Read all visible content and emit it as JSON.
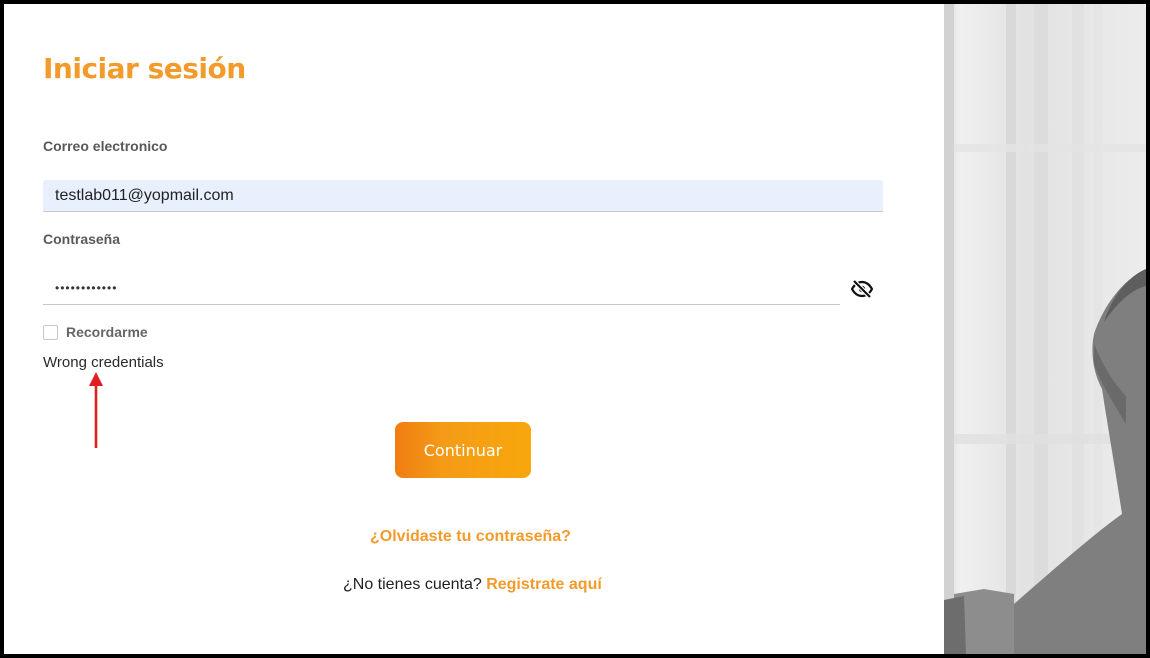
{
  "page": {
    "title": "Iniciar sesión"
  },
  "form": {
    "email_label": "Correo electronico",
    "email_value": "testlab011@yopmail.com",
    "password_label": "Contraseña",
    "password_value": "••••••••••••",
    "remember_label": "Recordarme",
    "error_message": "Wrong credentials",
    "submit_label": "Continuar",
    "forgot_link": "¿Olvidaste tu contraseña?",
    "register_prompt": "¿No tienes cuenta?",
    "register_link": "Registrate aquí"
  },
  "icons": {
    "password_toggle": "eye-slash-icon",
    "annotation": "red-arrow-icon"
  },
  "colors": {
    "accent": "#f29b2a",
    "button_start": "#f07d12",
    "button_end": "#f8a70c",
    "annotation": "#e02020",
    "autofill_bg": "#e8f0fe"
  }
}
